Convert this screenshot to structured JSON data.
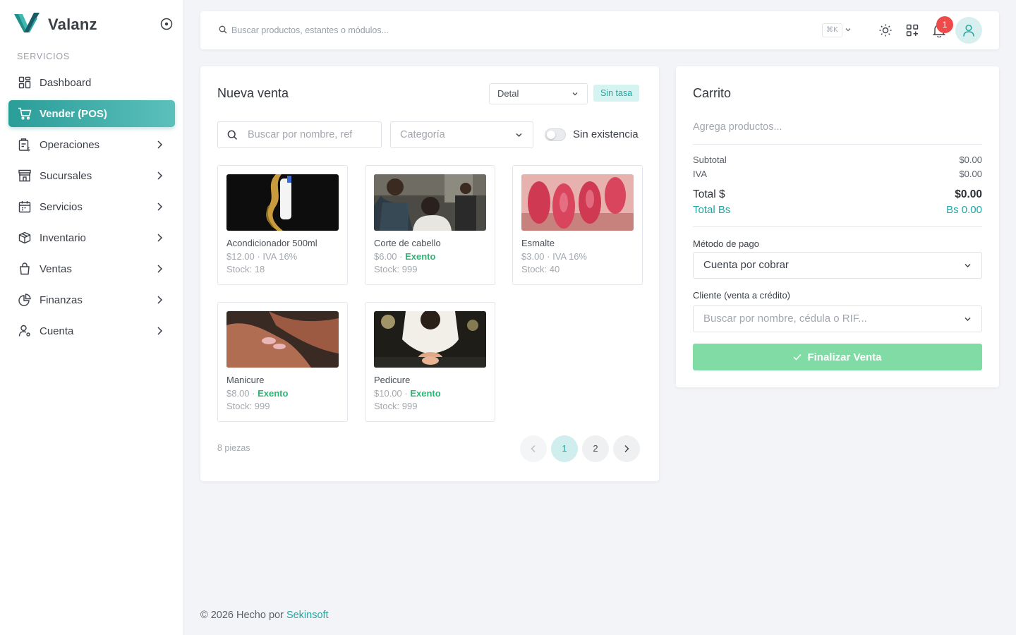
{
  "app": {
    "name": "Valanz"
  },
  "sidebar": {
    "section_label": "SERVICIOS",
    "items": [
      {
        "label": "Dashboard",
        "icon": "dashboard-icon"
      },
      {
        "label": "Vender (POS)",
        "icon": "cart-icon",
        "active": true
      },
      {
        "label": "Operaciones",
        "icon": "operations-icon"
      },
      {
        "label": "Sucursales",
        "icon": "store-icon"
      },
      {
        "label": "Servicios",
        "icon": "calendar-icon"
      },
      {
        "label": "Inventario",
        "icon": "box-icon"
      },
      {
        "label": "Ventas",
        "icon": "shopping-bag-icon"
      },
      {
        "label": "Finanzas",
        "icon": "pie-chart-icon"
      },
      {
        "label": "Cuenta",
        "icon": "user-settings-icon"
      }
    ]
  },
  "topbar": {
    "search_placeholder": "Buscar productos, estantes o módulos...",
    "shortcut": "⌘K",
    "notifications_count": "1"
  },
  "sales": {
    "title": "Nueva venta",
    "price_mode": "Detal",
    "rate_badge": "Sin tasa",
    "search_placeholder": "Buscar por nombre, ref",
    "category_placeholder": "Categoría",
    "stock_toggle_label": "Sin existencia",
    "products": [
      {
        "name": "Acondicionador 500ml",
        "price": "$12.00 · ",
        "tax": "IVA 16%",
        "exento": false,
        "stock": "Stock: 18"
      },
      {
        "name": "Corte de cabello",
        "price": "$6.00 · ",
        "tax": "Exento",
        "exento": true,
        "stock": "Stock: 999"
      },
      {
        "name": "Esmalte",
        "price": "$3.00 · ",
        "tax": "IVA 16%",
        "exento": false,
        "stock": "Stock: 40"
      },
      {
        "name": "Manicure",
        "price": "$8.00 · ",
        "tax": "Exento",
        "exento": true,
        "stock": "Stock: 999"
      },
      {
        "name": "Pedicure",
        "price": "$10.00 · ",
        "tax": "Exento",
        "exento": true,
        "stock": "Stock: 999"
      }
    ],
    "pieces_label": "8 piezas",
    "pages": [
      "1",
      "2"
    ],
    "current_page": "1"
  },
  "cart": {
    "title": "Carrito",
    "empty_text": "Agrega productos...",
    "subtotal_label": "Subtotal",
    "subtotal_value": "$0.00",
    "iva_label": "IVA",
    "iva_value": "$0.00",
    "total_usd_label": "Total $",
    "total_usd_value": "$0.00",
    "total_bs_label": "Total Bs",
    "total_bs_value": "Bs 0.00",
    "payment_label": "Método de pago",
    "payment_value": "Cuenta por cobrar",
    "client_label": "Cliente (venta a crédito)",
    "client_placeholder": "Buscar por nombre, cédula o RIF...",
    "finalize_label": "Finalizar Venta"
  },
  "footer": {
    "prefix": "© 2026 Hecho por ",
    "company": "Sekinsoft"
  },
  "colors": {
    "accent": "#21a6a1",
    "exento": "#2bb673",
    "finalize": "#80dba4",
    "badge": "#ef4a4a"
  }
}
